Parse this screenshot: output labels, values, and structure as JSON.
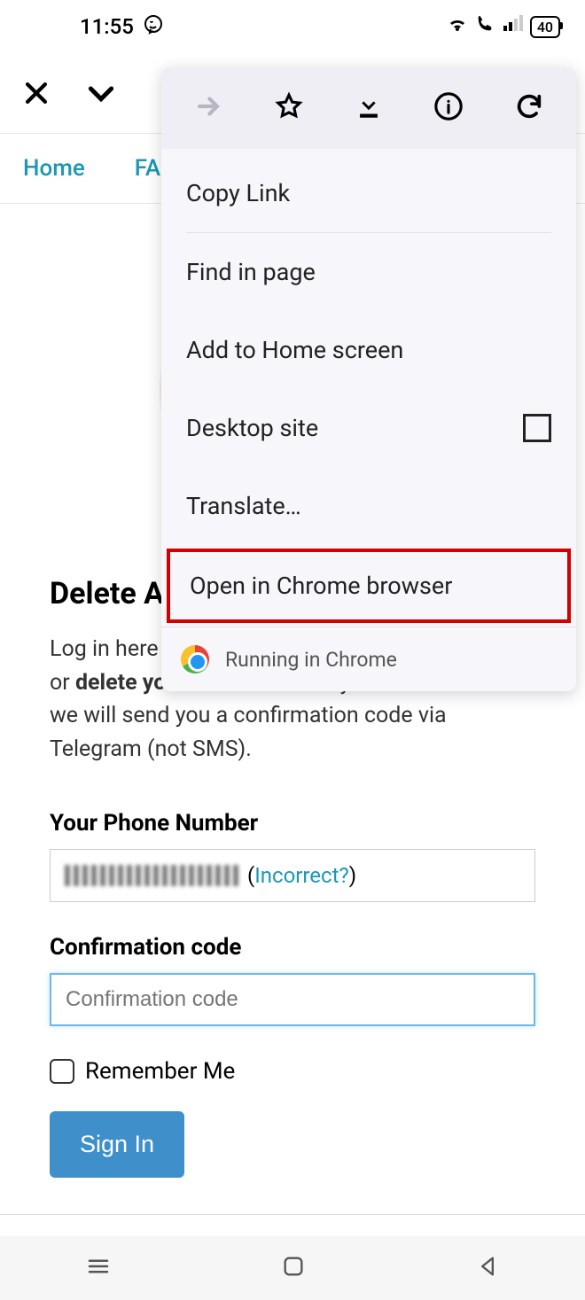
{
  "status": {
    "time": "11:55",
    "battery": "40"
  },
  "tabs": {
    "home": "Home",
    "faq": "FA"
  },
  "page": {
    "heading": "Delete A",
    "desc_prefix": "Log in here",
    "desc_middle": "Telegram API or ",
    "desc_bold": "delete your account",
    "desc_suffix": ". Enter your number and we will send you a confirmation code via Telegram (not SMS).",
    "phone_label": "Your Phone Number",
    "incorrect": "Incorrect?",
    "code_label": "Confirmation code",
    "code_placeholder": "Confirmation code",
    "remember": "Remember Me",
    "signin": "Sign In"
  },
  "menu": {
    "copy": "Copy Link",
    "find": "Find in page",
    "add": "Add to Home screen",
    "desktop": "Desktop site",
    "translate": "Translate…",
    "open": "Open in Chrome browser",
    "footer": "Running in Chrome"
  }
}
